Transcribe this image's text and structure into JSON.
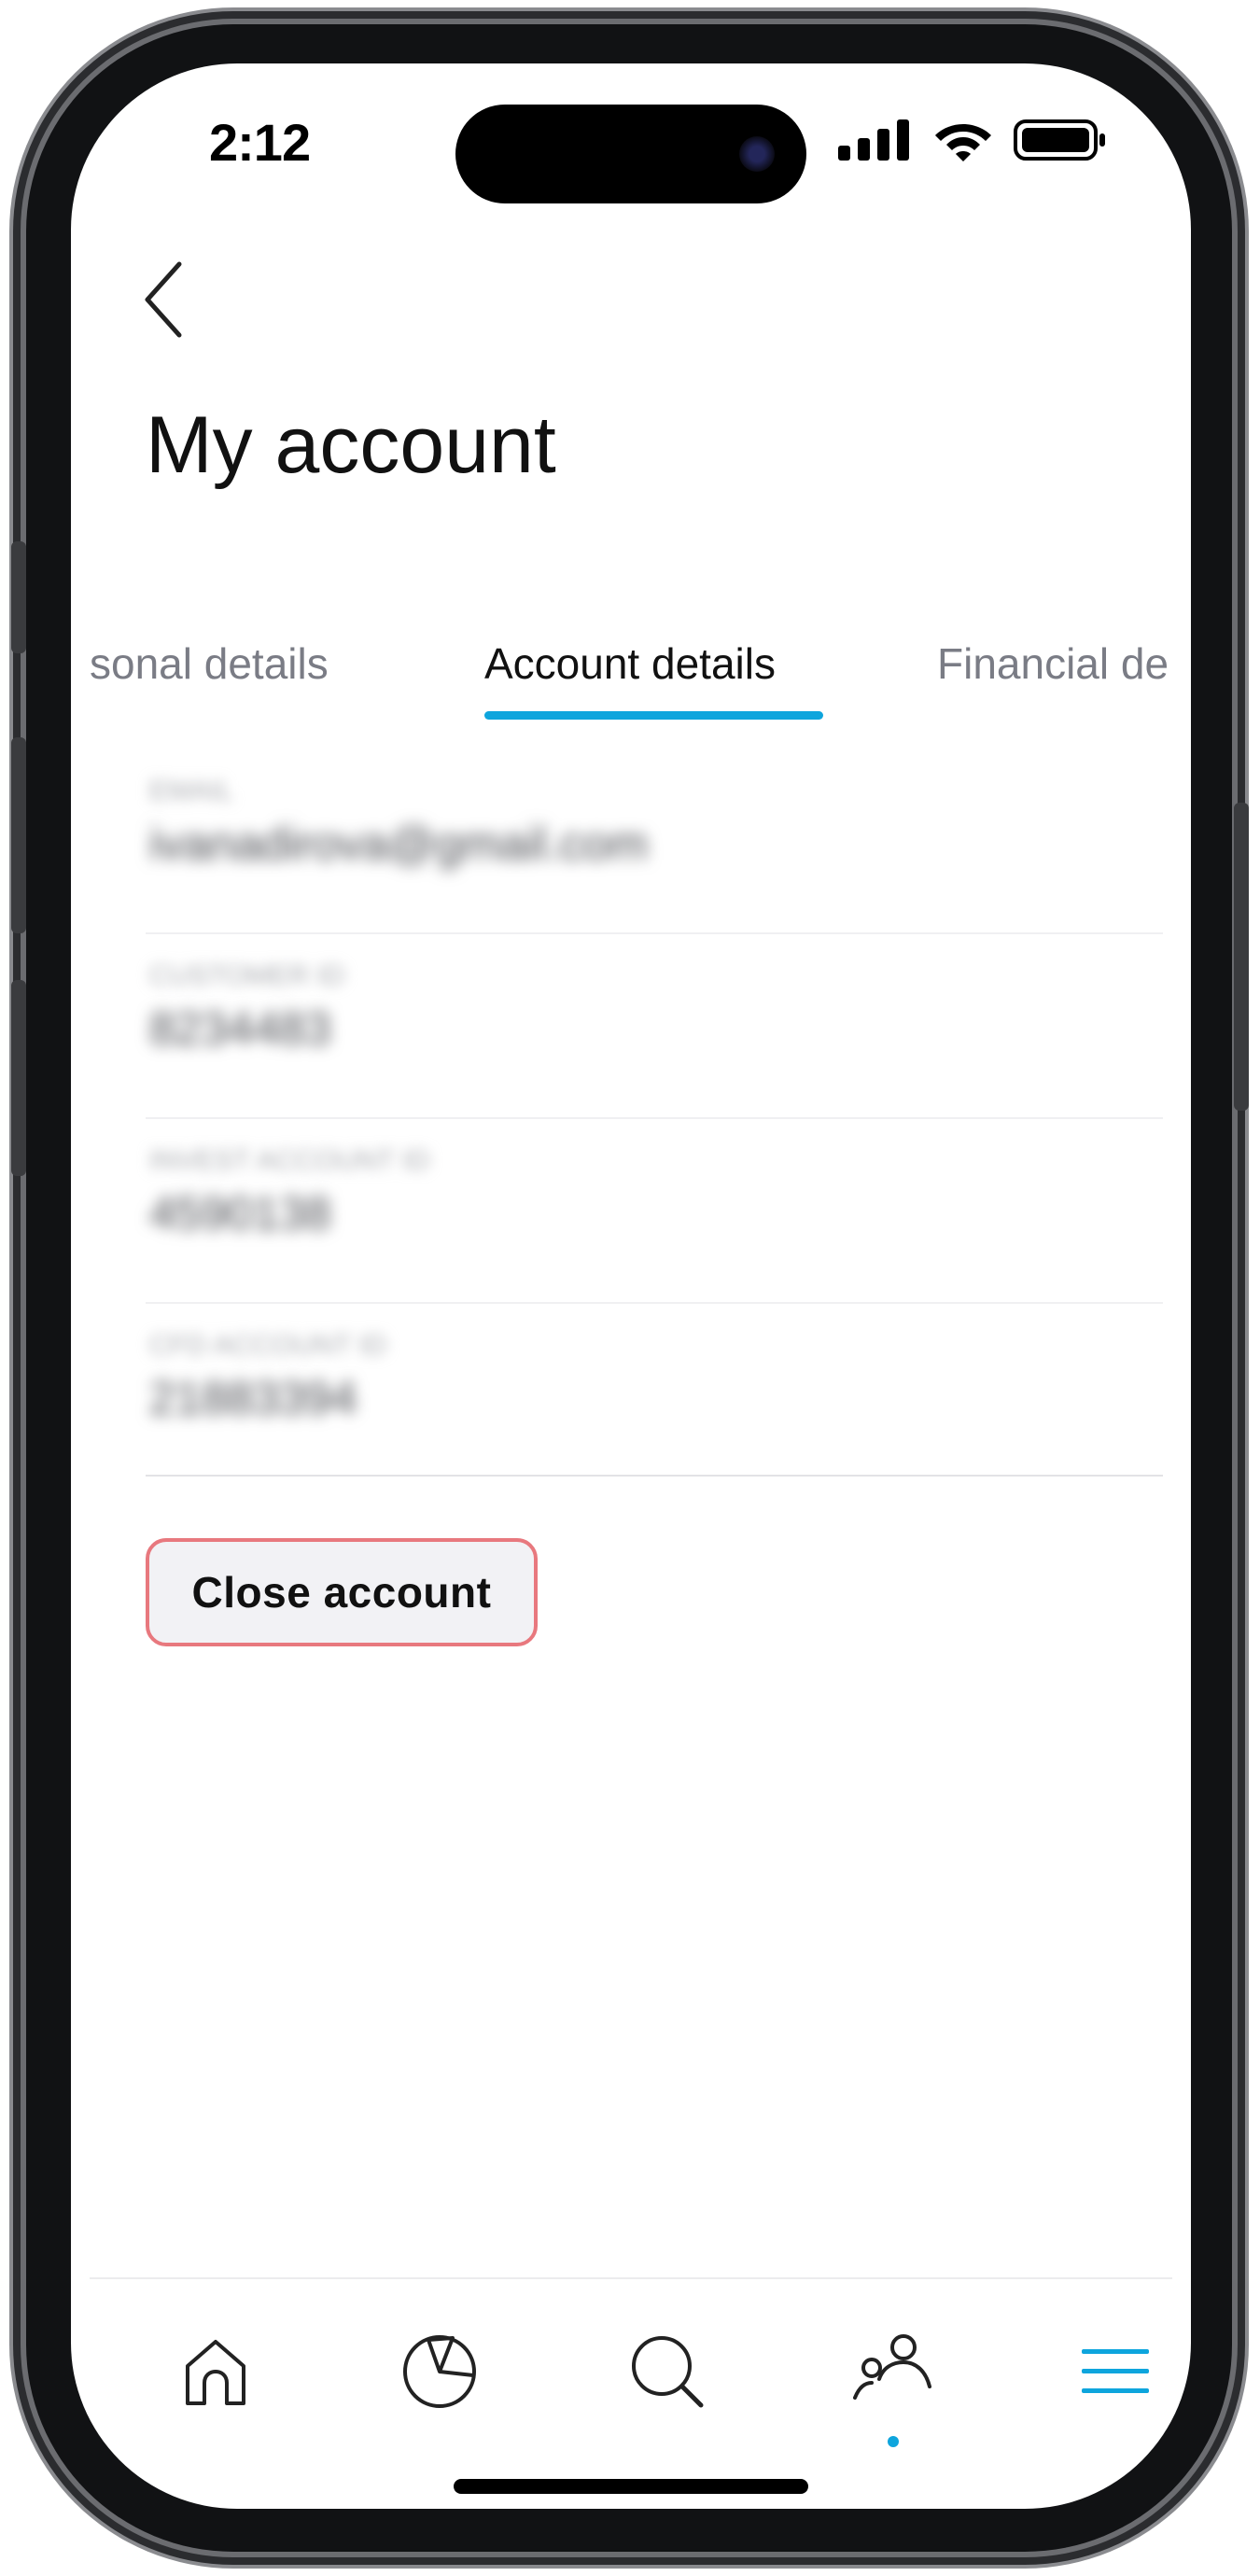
{
  "status_bar": {
    "time": "2:12"
  },
  "header": {
    "back_label": "Back",
    "title": "My account"
  },
  "tabs": [
    {
      "label": "Personal details",
      "visible_text": "sonal details",
      "active": false
    },
    {
      "label": "Account details",
      "visible_text": "Account details",
      "active": true
    },
    {
      "label": "Financial details",
      "visible_text": "Financial de",
      "active": false
    }
  ],
  "fields": [
    {
      "label": "EMAIL",
      "value": "ivanadirova@gmail.com"
    },
    {
      "label": "CUSTOMER ID",
      "value": "8234483"
    },
    {
      "label": "INVEST ACCOUNT ID",
      "value": "4590138"
    },
    {
      "label": "CFD ACCOUNT ID",
      "value": "21883394"
    }
  ],
  "actions": {
    "close_account": "Close account"
  },
  "bottom_nav": [
    {
      "name": "home",
      "icon": "home-icon"
    },
    {
      "name": "portfolio",
      "icon": "pie-chart-icon"
    },
    {
      "name": "search",
      "icon": "search-icon"
    },
    {
      "name": "social",
      "icon": "people-icon",
      "has_dot": true
    },
    {
      "name": "menu",
      "icon": "menu-icon",
      "active": true
    }
  ],
  "colors": {
    "accent": "#0ea5dd",
    "danger_border": "#e8787e",
    "button_bg": "#f2f2f5"
  }
}
